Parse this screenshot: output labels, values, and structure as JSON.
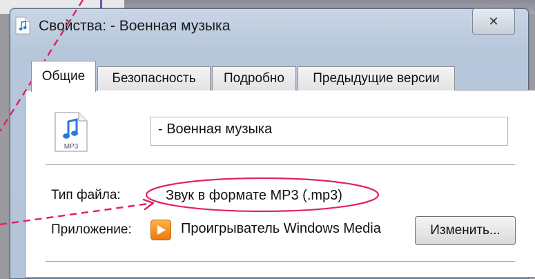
{
  "window": {
    "title": "Свойства:  - Военная музыка",
    "close_glyph": "✕"
  },
  "tabs": [
    {
      "label": "Общие",
      "active": true
    },
    {
      "label": "Безопасность",
      "active": false
    },
    {
      "label": "Подробно",
      "active": false
    },
    {
      "label": "Предыдущие версии",
      "active": false
    }
  ],
  "general": {
    "file_icon": "mp3-file-icon",
    "file_icon_caption": "MP3",
    "file_name": "- Военная музыка",
    "file_type_label": "Тип файла:",
    "file_type_value": "Звук в формате MP3 (.mp3)",
    "app_label": "Приложение:",
    "app_icon": "windows-media-player-icon",
    "app_name": "Проигрыватель Windows Media",
    "change_button": "Изменить..."
  },
  "colors": {
    "annotation": "#e0245e"
  }
}
